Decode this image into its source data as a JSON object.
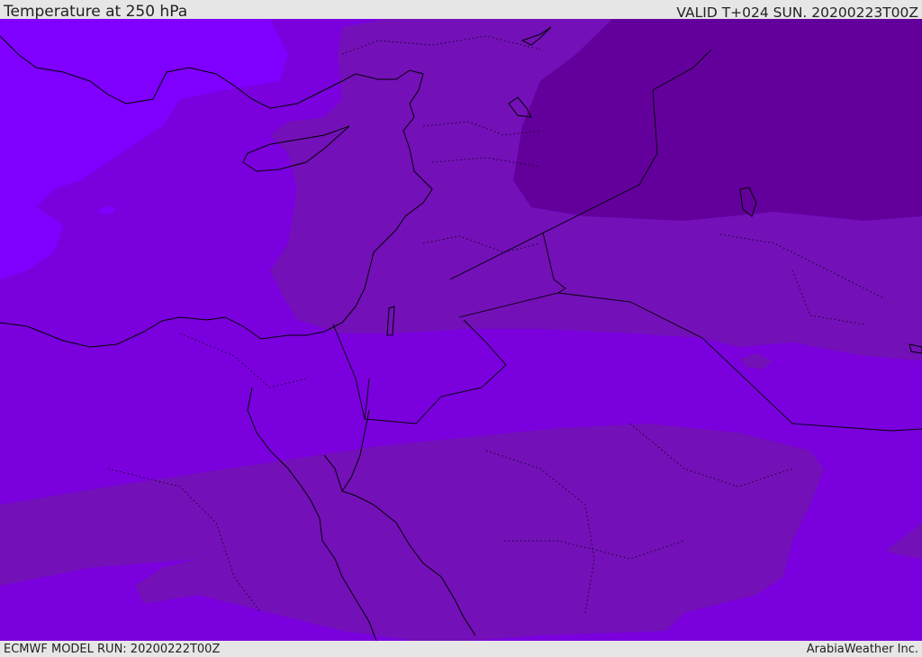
{
  "header": {
    "title": "Temperature at 250 hPa",
    "valid": "VALID T+024 SUN. 20200223T00Z"
  },
  "footer": {
    "model_run": "ECMWF MODEL RUN: 20200222T00Z",
    "credit": "ArabiaWeather Inc."
  },
  "colors": {
    "band_warmest": "#7f00ff",
    "band_mid": "#7a00de",
    "band_cool": "#7310b8",
    "band_coldest": "#63009c",
    "outline": "#000000"
  }
}
